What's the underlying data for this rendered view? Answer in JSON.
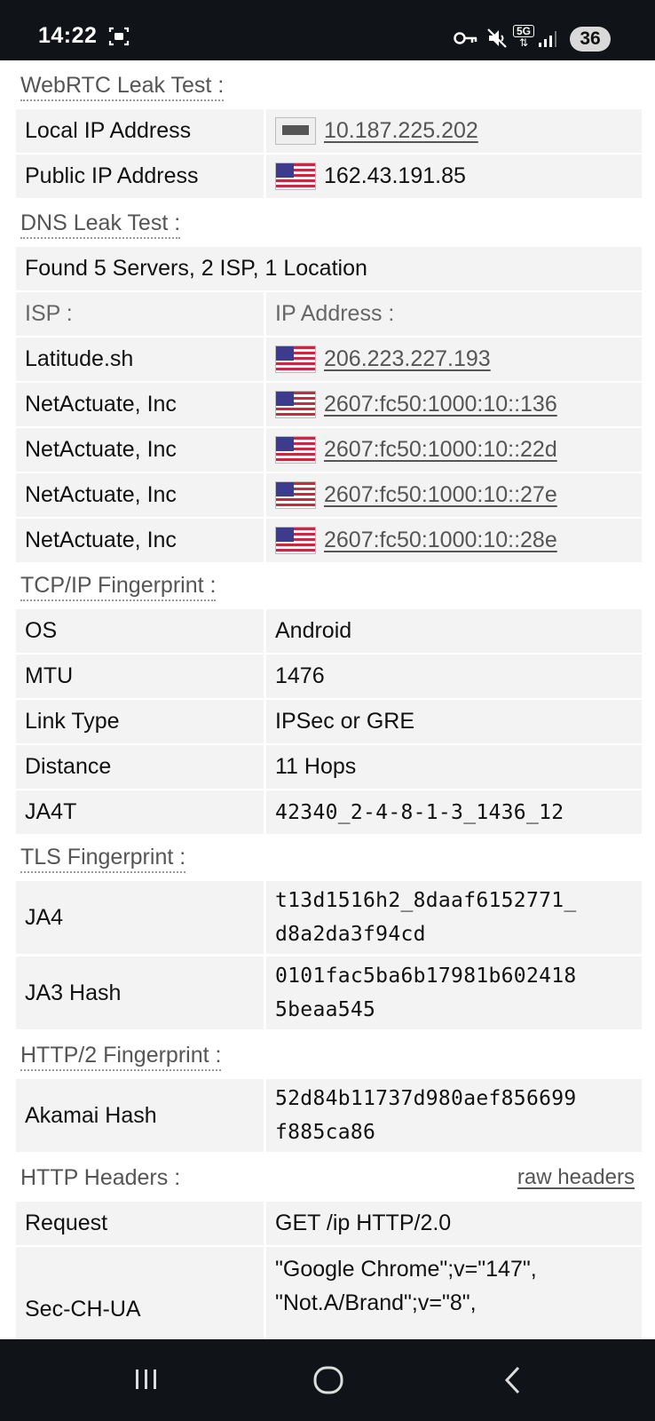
{
  "status_bar": {
    "time": "14:22",
    "network": "5G",
    "battery": "36",
    "icons": [
      "screenshot-icon",
      "vpn-key-icon",
      "mute-icon",
      "5g-icon",
      "signal-icon"
    ]
  },
  "webrtc": {
    "title": "WebRTC Leak Test :",
    "rows": [
      {
        "label": "Local IP Address",
        "value": "10.187.225.202",
        "icon": "lan-icon"
      },
      {
        "label": "Public IP Address",
        "value": "162.43.191.85",
        "icon": "us-flag-icon"
      }
    ]
  },
  "dns": {
    "title": "DNS Leak Test :",
    "summary": "Found 5 Servers, 2 ISP, 1 Location",
    "col_isp": "ISP :",
    "col_ip": "IP Address :",
    "rows": [
      {
        "isp": "Latitude.sh",
        "ip": "206.223.227.193"
      },
      {
        "isp": "NetActuate, Inc",
        "ip": "2607:fc50:1000:10::136"
      },
      {
        "isp": "NetActuate, Inc",
        "ip": "2607:fc50:1000:10::22d"
      },
      {
        "isp": "NetActuate, Inc",
        "ip": "2607:fc50:1000:10::27e"
      },
      {
        "isp": "NetActuate, Inc",
        "ip": "2607:fc50:1000:10::28e"
      }
    ]
  },
  "tcpip": {
    "title": "TCP/IP Fingerprint :",
    "rows": [
      {
        "label": "OS",
        "value": "Android"
      },
      {
        "label": "MTU",
        "value": "1476"
      },
      {
        "label": "Link Type",
        "value": "IPSec or GRE"
      },
      {
        "label": "Distance",
        "value": "11 Hops"
      },
      {
        "label": "JA4T",
        "value": "42340_2-4-8-1-3_1436_12"
      }
    ]
  },
  "tls": {
    "title": "TLS Fingerprint :",
    "rows": [
      {
        "label": "JA4",
        "line1": "t13d1516h2_8daaf6152771_",
        "line2": "d8a2da3f94cd"
      },
      {
        "label": "JA3 Hash",
        "line1": "0101fac5ba6b17981b602418",
        "line2": "5beaa545"
      }
    ]
  },
  "http2": {
    "title": "HTTP/2 Fingerprint :",
    "rows": [
      {
        "label": "Akamai Hash",
        "line1": "52d84b11737d980aef856699",
        "line2": "f885ca86"
      }
    ]
  },
  "headers": {
    "title": "HTTP Headers :",
    "raw_link": "raw headers",
    "rows": [
      {
        "label": "Request",
        "value": "GET /ip HTTP/2.0"
      },
      {
        "label": "Sec-CH-UA",
        "line1": "\"Google Chrome\";v=\"147\",",
        "line2": "\"Not.A/Brand\";v=\"8\","
      }
    ]
  },
  "nav": {
    "buttons": [
      "recents-button",
      "home-button",
      "back-button"
    ]
  }
}
